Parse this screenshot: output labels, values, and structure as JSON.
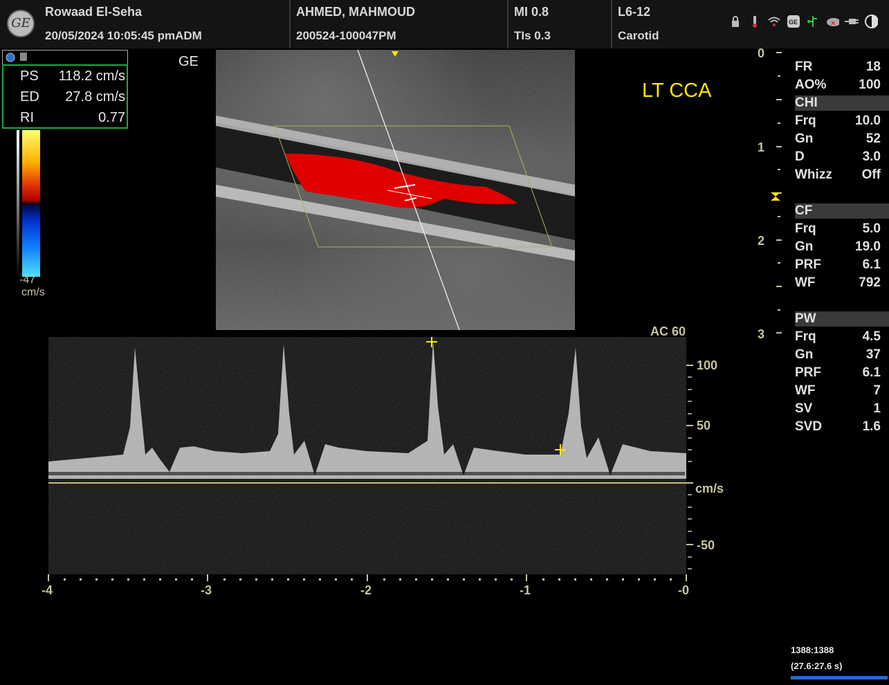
{
  "header": {
    "logo": "GE",
    "hospital": "Rowaad El-Seha",
    "datetime": "20/05/2024 10:05:45 pmADM",
    "patient_name": "AHMED, MAHMOUD",
    "patient_id": "200524-100047PM",
    "mi": "MI 0.8",
    "tis": "TIs 0.3",
    "probe": "L6-12",
    "preset": "Carotid",
    "status_icons": [
      "lock-icon",
      "usb-icon",
      "wifi-icon",
      "ge-icon",
      "network-icon",
      "cloud-error-icon",
      "plug-icon",
      "half-circle-icon"
    ]
  },
  "measurements": {
    "rows": [
      {
        "label": "PS",
        "value": "118.2 cm/s"
      },
      {
        "label": "ED",
        "value": "27.8 cm/s"
      },
      {
        "label": "RI",
        "value": "0.77"
      }
    ]
  },
  "image": {
    "brand": "GE",
    "vessel_label": "LT CCA",
    "color_scale_min": "-47",
    "color_scale_unit": "cm/s"
  },
  "depth_scale": [
    "0",
    "1",
    "2",
    "3"
  ],
  "params": {
    "general": [
      {
        "label": "FR",
        "value": "18"
      },
      {
        "label": "AO%",
        "value": "100"
      }
    ],
    "chi": {
      "title": "CHI",
      "rows": [
        {
          "label": "Frq",
          "value": "10.0"
        },
        {
          "label": "Gn",
          "value": "52"
        },
        {
          "label": "D",
          "value": "3.0"
        },
        {
          "label": "Whizz",
          "value": "Off"
        }
      ]
    },
    "cf": {
      "title": "CF",
      "rows": [
        {
          "label": "Frq",
          "value": "5.0"
        },
        {
          "label": "Gn",
          "value": "19.0"
        },
        {
          "label": "PRF",
          "value": "6.1"
        },
        {
          "label": "WF",
          "value": "792"
        }
      ]
    },
    "pw": {
      "title": "PW",
      "rows": [
        {
          "label": "Frq",
          "value": "4.5"
        },
        {
          "label": "Gn",
          "value": "37"
        },
        {
          "label": "PRF",
          "value": "6.1"
        },
        {
          "label": "WF",
          "value": "7"
        },
        {
          "label": "SV",
          "value": "1"
        },
        {
          "label": "SVD",
          "value": "1.6"
        }
      ]
    }
  },
  "spectral": {
    "ac_label": "AC 60",
    "velocity_ticks": [
      "100",
      "50",
      "cm/s",
      "-50"
    ],
    "time_ticks": [
      "-4",
      "-3",
      "-2",
      "-1",
      "-0"
    ]
  },
  "cine": {
    "frames": "1388:1388",
    "time": "(27.6:27.6 s)"
  }
}
